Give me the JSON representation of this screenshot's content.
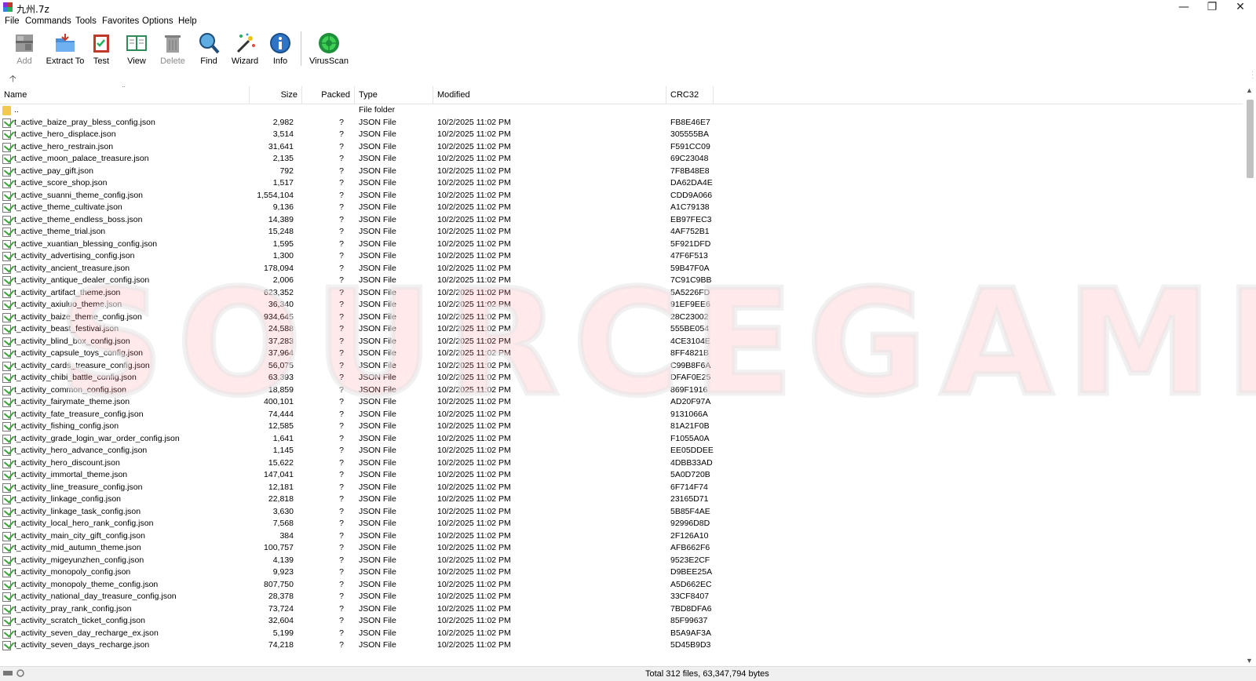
{
  "window": {
    "title": "九州.7z"
  },
  "menu": [
    "File",
    "Commands",
    "Tools",
    "Favorites",
    "Options",
    "Help"
  ],
  "toolbar": [
    {
      "label": "Add",
      "icon": "add-archive-icon",
      "enabled": false
    },
    {
      "label": "Extract To",
      "icon": "extract-folder-icon",
      "enabled": true
    },
    {
      "label": "Test",
      "icon": "test-icon",
      "enabled": true
    },
    {
      "label": "View",
      "icon": "view-book-icon",
      "enabled": true
    },
    {
      "label": "Delete",
      "icon": "trash-icon",
      "enabled": false
    },
    {
      "label": "Find",
      "icon": "magnifier-icon",
      "enabled": true
    },
    {
      "label": "Wizard",
      "icon": "wand-icon",
      "enabled": true
    },
    {
      "label": "Info",
      "icon": "info-icon",
      "enabled": true
    },
    {
      "label": "VirusScan",
      "icon": "virus-icon",
      "enabled": true
    }
  ],
  "columns": {
    "name": "Name",
    "size": "Size",
    "packed": "Packed",
    "type": "Type",
    "modified": "Modified",
    "crc": "CRC32"
  },
  "parent_row": {
    "name": "..",
    "type": "File folder"
  },
  "files": [
    [
      "t_active_baize_pray_bless_config.json",
      "2,982",
      "FB8E46E7"
    ],
    [
      "t_active_hero_displace.json",
      "3,514",
      "305555BA"
    ],
    [
      "t_active_hero_restrain.json",
      "31,641",
      "F591CC09"
    ],
    [
      "t_active_moon_palace_treasure.json",
      "2,135",
      "69C23048"
    ],
    [
      "t_active_pay_gift.json",
      "792",
      "7F8B48E8"
    ],
    [
      "t_active_score_shop.json",
      "1,517",
      "DA62DA4E"
    ],
    [
      "t_active_suanni_theme_config.json",
      "1,554,104",
      "CDD9A066"
    ],
    [
      "t_active_theme_cultivate.json",
      "9,136",
      "A1C79138"
    ],
    [
      "t_active_theme_endless_boss.json",
      "14,389",
      "EB97FEC3"
    ],
    [
      "t_active_theme_trial.json",
      "15,248",
      "4AF752B1"
    ],
    [
      "t_active_xuantian_blessing_config.json",
      "1,595",
      "5F921DFD"
    ],
    [
      "t_activity_advertising_config.json",
      "1,300",
      "47F6F513"
    ],
    [
      "t_activity_ancient_treasure.json",
      "178,094",
      "59B47F0A"
    ],
    [
      "t_activity_antique_dealer_config.json",
      "2,006",
      "7C91C9BB"
    ],
    [
      "t_activity_artifact_theme.json",
      "623,352",
      "5A5226FD"
    ],
    [
      "t_activity_axiuluo_theme.json",
      "36,340",
      "91EF9EE6"
    ],
    [
      "t_activity_baize_theme_config.json",
      "934,645",
      "28C23002"
    ],
    [
      "t_activity_beast_festival.json",
      "24,588",
      "555BE054"
    ],
    [
      "t_activity_blind_box_config.json",
      "37,283",
      "4CE3104E"
    ],
    [
      "t_activity_capsule_toys_config.json",
      "37,964",
      "8FF4821B"
    ],
    [
      "t_activity_cards_treasure_config.json",
      "56,075",
      "C99B8F6A"
    ],
    [
      "t_activity_chibi_battle_config.json",
      "63,393",
      "DFAF0E25"
    ],
    [
      "t_activity_common_config.json",
      "18,859",
      "869F1916"
    ],
    [
      "t_activity_fairymate_theme.json",
      "400,101",
      "AD20F97A"
    ],
    [
      "t_activity_fate_treasure_config.json",
      "74,444",
      "9131066A"
    ],
    [
      "t_activity_fishing_config.json",
      "12,585",
      "81A21F0B"
    ],
    [
      "t_activity_grade_login_war_order_config.json",
      "1,641",
      "F1055A0A"
    ],
    [
      "t_activity_hero_advance_config.json",
      "1,145",
      "EE05DDEE"
    ],
    [
      "t_activity_hero_discount.json",
      "15,622",
      "4DBB33AD"
    ],
    [
      "t_activity_immortal_theme.json",
      "147,041",
      "5A0D720B"
    ],
    [
      "t_activity_line_treasure_config.json",
      "12,181",
      "6F714F74"
    ],
    [
      "t_activity_linkage_config.json",
      "22,818",
      "23165D71"
    ],
    [
      "t_activity_linkage_task_config.json",
      "3,630",
      "5B85F4AE"
    ],
    [
      "t_activity_local_hero_rank_config.json",
      "7,568",
      "92996D8D"
    ],
    [
      "t_activity_main_city_gift_config.json",
      "384",
      "2F126A10"
    ],
    [
      "t_activity_mid_autumn_theme.json",
      "100,757",
      "AFB662F6"
    ],
    [
      "t_activity_migeyunzhen_config.json",
      "4,139",
      "9523E2CF"
    ],
    [
      "t_activity_monopoly_config.json",
      "9,923",
      "D9BEE25A"
    ],
    [
      "t_activity_monopoly_theme_config.json",
      "807,750",
      "A5D662EC"
    ],
    [
      "t_activity_national_day_treasure_config.json",
      "28,378",
      "33CF8407"
    ],
    [
      "t_activity_pray_rank_config.json",
      "73,724",
      "7BD8DFA6"
    ],
    [
      "t_activity_scratch_ticket_config.json",
      "32,604",
      "85F99637"
    ],
    [
      "t_activity_seven_day_recharge_ex.json",
      "5,199",
      "B5A9AF3A"
    ],
    [
      "t_activity_seven_days_recharge.json",
      "74,218",
      "5D45B9D3"
    ]
  ],
  "file_defaults": {
    "packed": "?",
    "type": "JSON File",
    "modified": "10/2/2025 11:02 PM"
  },
  "status": {
    "text": "Total 312 files, 63,347,794 bytes"
  },
  "watermark": "SOURCEGAME.NET",
  "colors": {
    "accent_green": "#3ba43b",
    "folder_yellow": "#f2c94c",
    "watermark": "#ff7882"
  }
}
